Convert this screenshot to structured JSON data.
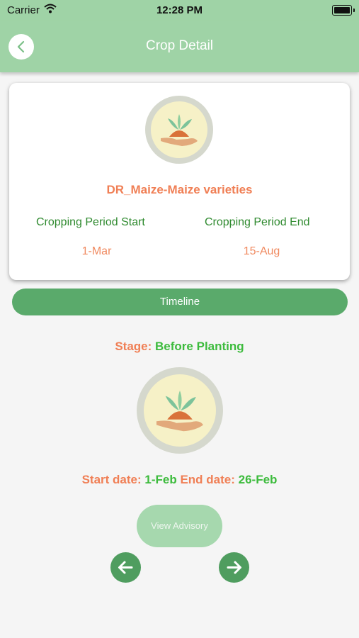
{
  "status_bar": {
    "carrier": "Carrier",
    "time": "12:28 PM",
    "icons": [
      "wifi-icon",
      "battery-icon"
    ]
  },
  "header": {
    "title": "Crop Detail",
    "back_icon": "chevron-left-icon"
  },
  "crop_card": {
    "image_icon": "plant-in-hand-icon",
    "crop_name": "DR_Maize-Maize varieties",
    "period_start_label": "Cropping Period Start",
    "period_start_value": "1-Mar",
    "period_end_label": "Cropping Period End",
    "period_end_value": "15-Aug"
  },
  "timeline": {
    "button_label": "Timeline"
  },
  "stage": {
    "prefix": "Stage:",
    "name": "Before Planting",
    "image_icon": "plant-in-hand-icon",
    "start_prefix": "Start date:",
    "start_value": "1-Feb",
    "end_prefix": "End date:",
    "end_value": "26-Feb"
  },
  "actions": {
    "view_advisory_label": "View Advisory",
    "prev_icon": "arrow-left-icon",
    "next_icon": "arrow-right-icon"
  },
  "colors": {
    "header_bg": "#9fd3a6",
    "accent_green": "#5aaa6b",
    "orange": "#f07f55",
    "green_text": "#3cbb3c"
  }
}
